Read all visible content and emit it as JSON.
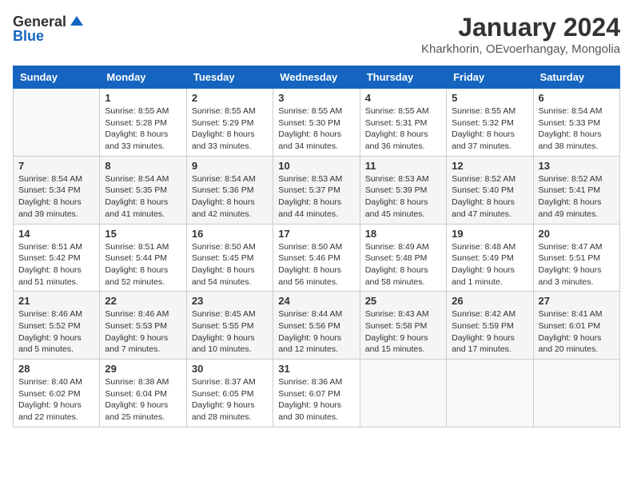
{
  "header": {
    "logo_general": "General",
    "logo_blue": "Blue",
    "title": "January 2024",
    "subtitle": "Kharkhorin, OEvoerhangay, Mongolia"
  },
  "weekdays": [
    "Sunday",
    "Monday",
    "Tuesday",
    "Wednesday",
    "Thursday",
    "Friday",
    "Saturday"
  ],
  "weeks": [
    [
      {
        "day": "",
        "info": ""
      },
      {
        "day": "1",
        "info": "Sunrise: 8:55 AM\nSunset: 5:28 PM\nDaylight: 8 hours\nand 33 minutes."
      },
      {
        "day": "2",
        "info": "Sunrise: 8:55 AM\nSunset: 5:29 PM\nDaylight: 8 hours\nand 33 minutes."
      },
      {
        "day": "3",
        "info": "Sunrise: 8:55 AM\nSunset: 5:30 PM\nDaylight: 8 hours\nand 34 minutes."
      },
      {
        "day": "4",
        "info": "Sunrise: 8:55 AM\nSunset: 5:31 PM\nDaylight: 8 hours\nand 36 minutes."
      },
      {
        "day": "5",
        "info": "Sunrise: 8:55 AM\nSunset: 5:32 PM\nDaylight: 8 hours\nand 37 minutes."
      },
      {
        "day": "6",
        "info": "Sunrise: 8:54 AM\nSunset: 5:33 PM\nDaylight: 8 hours\nand 38 minutes."
      }
    ],
    [
      {
        "day": "7",
        "info": "Sunrise: 8:54 AM\nSunset: 5:34 PM\nDaylight: 8 hours\nand 39 minutes."
      },
      {
        "day": "8",
        "info": "Sunrise: 8:54 AM\nSunset: 5:35 PM\nDaylight: 8 hours\nand 41 minutes."
      },
      {
        "day": "9",
        "info": "Sunrise: 8:54 AM\nSunset: 5:36 PM\nDaylight: 8 hours\nand 42 minutes."
      },
      {
        "day": "10",
        "info": "Sunrise: 8:53 AM\nSunset: 5:37 PM\nDaylight: 8 hours\nand 44 minutes."
      },
      {
        "day": "11",
        "info": "Sunrise: 8:53 AM\nSunset: 5:39 PM\nDaylight: 8 hours\nand 45 minutes."
      },
      {
        "day": "12",
        "info": "Sunrise: 8:52 AM\nSunset: 5:40 PM\nDaylight: 8 hours\nand 47 minutes."
      },
      {
        "day": "13",
        "info": "Sunrise: 8:52 AM\nSunset: 5:41 PM\nDaylight: 8 hours\nand 49 minutes."
      }
    ],
    [
      {
        "day": "14",
        "info": "Sunrise: 8:51 AM\nSunset: 5:42 PM\nDaylight: 8 hours\nand 51 minutes."
      },
      {
        "day": "15",
        "info": "Sunrise: 8:51 AM\nSunset: 5:44 PM\nDaylight: 8 hours\nand 52 minutes."
      },
      {
        "day": "16",
        "info": "Sunrise: 8:50 AM\nSunset: 5:45 PM\nDaylight: 8 hours\nand 54 minutes."
      },
      {
        "day": "17",
        "info": "Sunrise: 8:50 AM\nSunset: 5:46 PM\nDaylight: 8 hours\nand 56 minutes."
      },
      {
        "day": "18",
        "info": "Sunrise: 8:49 AM\nSunset: 5:48 PM\nDaylight: 8 hours\nand 58 minutes."
      },
      {
        "day": "19",
        "info": "Sunrise: 8:48 AM\nSunset: 5:49 PM\nDaylight: 9 hours\nand 1 minute."
      },
      {
        "day": "20",
        "info": "Sunrise: 8:47 AM\nSunset: 5:51 PM\nDaylight: 9 hours\nand 3 minutes."
      }
    ],
    [
      {
        "day": "21",
        "info": "Sunrise: 8:46 AM\nSunset: 5:52 PM\nDaylight: 9 hours\nand 5 minutes."
      },
      {
        "day": "22",
        "info": "Sunrise: 8:46 AM\nSunset: 5:53 PM\nDaylight: 9 hours\nand 7 minutes."
      },
      {
        "day": "23",
        "info": "Sunrise: 8:45 AM\nSunset: 5:55 PM\nDaylight: 9 hours\nand 10 minutes."
      },
      {
        "day": "24",
        "info": "Sunrise: 8:44 AM\nSunset: 5:56 PM\nDaylight: 9 hours\nand 12 minutes."
      },
      {
        "day": "25",
        "info": "Sunrise: 8:43 AM\nSunset: 5:58 PM\nDaylight: 9 hours\nand 15 minutes."
      },
      {
        "day": "26",
        "info": "Sunrise: 8:42 AM\nSunset: 5:59 PM\nDaylight: 9 hours\nand 17 minutes."
      },
      {
        "day": "27",
        "info": "Sunrise: 8:41 AM\nSunset: 6:01 PM\nDaylight: 9 hours\nand 20 minutes."
      }
    ],
    [
      {
        "day": "28",
        "info": "Sunrise: 8:40 AM\nSunset: 6:02 PM\nDaylight: 9 hours\nand 22 minutes."
      },
      {
        "day": "29",
        "info": "Sunrise: 8:38 AM\nSunset: 6:04 PM\nDaylight: 9 hours\nand 25 minutes."
      },
      {
        "day": "30",
        "info": "Sunrise: 8:37 AM\nSunset: 6:05 PM\nDaylight: 9 hours\nand 28 minutes."
      },
      {
        "day": "31",
        "info": "Sunrise: 8:36 AM\nSunset: 6:07 PM\nDaylight: 9 hours\nand 30 minutes."
      },
      {
        "day": "",
        "info": ""
      },
      {
        "day": "",
        "info": ""
      },
      {
        "day": "",
        "info": ""
      }
    ]
  ]
}
